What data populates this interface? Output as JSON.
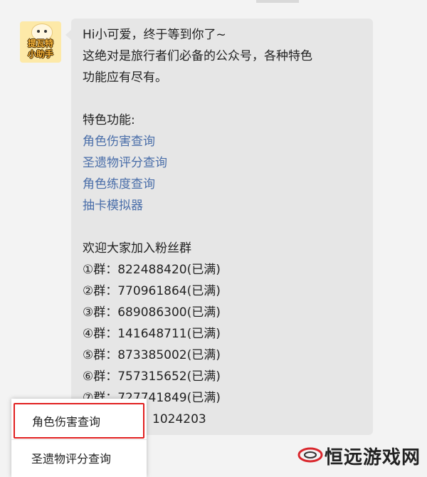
{
  "avatar": {
    "line1": "提瓦特",
    "line2": "小助手"
  },
  "message": {
    "intro": [
      "Hi小可爱，终于等到你了~",
      "这绝对是旅行者们必备的公众号，各种特色",
      "功能应有尽有。"
    ],
    "features_title": "特色功能:",
    "features": [
      "角色伤害查询",
      "圣遗物评分查询",
      "角色练度查询",
      "抽卡模拟器"
    ],
    "groups_title": "欢迎大家加入粉丝群",
    "groups": [
      "①群：822488420(已满)",
      "②群：770961864(已满)",
      "③群：689086300(已满)",
      "④群：141648711(已满)",
      "⑤群：873385002(已满)",
      "⑥群：757315652(已满)",
      "⑦群：727741849(已满)",
      "1024203"
    ]
  },
  "menu": {
    "items": [
      "角色伤害查询",
      "圣遗物评分查询"
    ]
  },
  "watermark": {
    "text": "恒远游戏网"
  },
  "colors": {
    "link": "#4a6ea9",
    "highlight": "#e11f1f",
    "bubble": "#e6e6e6"
  }
}
